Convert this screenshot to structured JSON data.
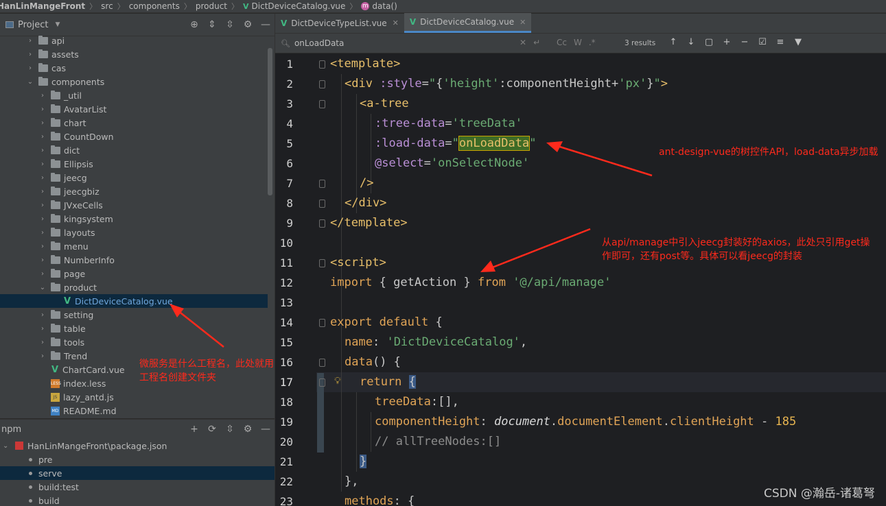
{
  "breadcrumb": {
    "items": [
      "HanLinMangeFront",
      "src",
      "components",
      "product",
      "DictDeviceCatalog.vue",
      "data()"
    ]
  },
  "project_panel": {
    "title": "Project",
    "tree": [
      {
        "label": "api",
        "type": "folder",
        "depth": 2,
        "expanded": false
      },
      {
        "label": "assets",
        "type": "folder",
        "depth": 2,
        "expanded": false
      },
      {
        "label": "cas",
        "type": "folder",
        "depth": 2,
        "expanded": false
      },
      {
        "label": "components",
        "type": "folder",
        "depth": 2,
        "expanded": true
      },
      {
        "label": "_util",
        "type": "folder",
        "depth": 3,
        "expanded": false
      },
      {
        "label": "AvatarList",
        "type": "folder",
        "depth": 3,
        "expanded": false
      },
      {
        "label": "chart",
        "type": "folder",
        "depth": 3,
        "expanded": false
      },
      {
        "label": "CountDown",
        "type": "folder",
        "depth": 3,
        "expanded": false
      },
      {
        "label": "dict",
        "type": "folder",
        "depth": 3,
        "expanded": false
      },
      {
        "label": "Ellipsis",
        "type": "folder",
        "depth": 3,
        "expanded": false
      },
      {
        "label": "jeecg",
        "type": "folder",
        "depth": 3,
        "expanded": false
      },
      {
        "label": "jeecgbiz",
        "type": "folder",
        "depth": 3,
        "expanded": false
      },
      {
        "label": "JVxeCells",
        "type": "folder",
        "depth": 3,
        "expanded": false
      },
      {
        "label": "kingsystem",
        "type": "folder",
        "depth": 3,
        "expanded": false
      },
      {
        "label": "layouts",
        "type": "folder",
        "depth": 3,
        "expanded": false
      },
      {
        "label": "menu",
        "type": "folder",
        "depth": 3,
        "expanded": false
      },
      {
        "label": "NumberInfo",
        "type": "folder",
        "depth": 3,
        "expanded": false
      },
      {
        "label": "page",
        "type": "folder",
        "depth": 3,
        "expanded": false
      },
      {
        "label": "product",
        "type": "folder",
        "depth": 3,
        "expanded": true
      },
      {
        "label": "DictDeviceCatalog.vue",
        "type": "vue",
        "depth": 4,
        "selected": true
      },
      {
        "label": "setting",
        "type": "folder",
        "depth": 3,
        "expanded": false
      },
      {
        "label": "table",
        "type": "folder",
        "depth": 3,
        "expanded": false
      },
      {
        "label": "tools",
        "type": "folder",
        "depth": 3,
        "expanded": false
      },
      {
        "label": "Trend",
        "type": "folder",
        "depth": 3,
        "expanded": false
      },
      {
        "label": "ChartCard.vue",
        "type": "vue",
        "depth": 3
      },
      {
        "label": "index.less",
        "type": "less",
        "depth": 3
      },
      {
        "label": "lazy_antd.js",
        "type": "js",
        "depth": 3
      },
      {
        "label": "README.md",
        "type": "md",
        "depth": 3
      }
    ]
  },
  "npm_panel": {
    "title": "npm",
    "package": "HanLinMangeFront\\package.json",
    "scripts": [
      "pre",
      "serve",
      "build:test",
      "build"
    ],
    "selected": "serve"
  },
  "editor": {
    "tabs": [
      {
        "label": "DictDeviceTypeList.vue",
        "active": false
      },
      {
        "label": "DictDeviceCatalog.vue",
        "active": true
      }
    ],
    "search": {
      "value": "onLoadData",
      "results": "3 results"
    },
    "line_numbers": [
      "1",
      "2",
      "3",
      "4",
      "5",
      "6",
      "7",
      "8",
      "9",
      "10",
      "11",
      "12",
      "13",
      "14",
      "15",
      "16",
      "17",
      "18",
      "19",
      "20",
      "21",
      "22",
      "23"
    ],
    "current_line": 17
  },
  "annotations": {
    "note1": "ant-design-vue的树控件API，load-data异步加载",
    "note2": "从api/manage中引入jeecg封装好的axios，此处只引用get操作即可，还有post等。具体可以看jeecg的封装",
    "note3": "微服务是什么工程名，此处就用工程名创建文件夹"
  },
  "watermark": "CSDN @瀚岳-诸葛弩",
  "colors": {
    "annotation": "#ff2a1c",
    "selection": "#0d293e",
    "vue_icon": "#41b883",
    "search_highlight": "#3e6b26"
  }
}
